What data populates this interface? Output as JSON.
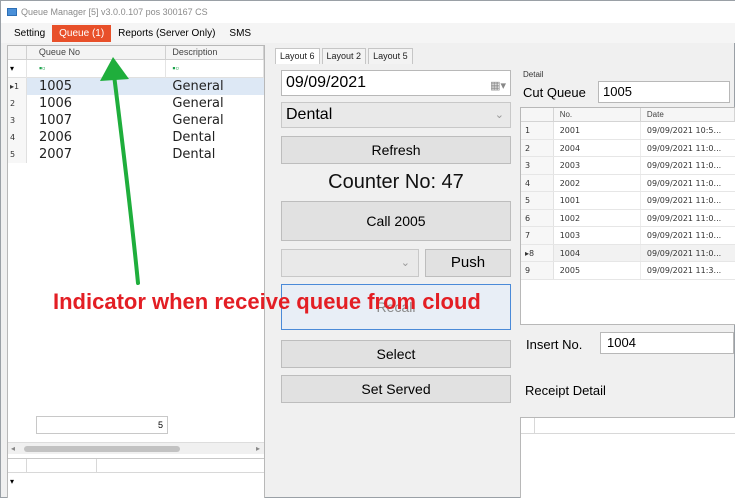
{
  "window": {
    "title": "Queue Manager [5] v3.0.0.107 pos 300167 CS"
  },
  "menu": {
    "items": [
      {
        "label": "Setting",
        "active": false
      },
      {
        "label": "Queue (1)",
        "active": true
      },
      {
        "label": "Reports (Server Only)",
        "active": false
      },
      {
        "label": "SMS",
        "active": false
      }
    ]
  },
  "queue_grid": {
    "columns": [
      "Queue No",
      "Description"
    ],
    "rows": [
      {
        "indicator": "▸1",
        "queue_no": "1005",
        "description": "General",
        "selected": true
      },
      {
        "indicator": "2",
        "queue_no": "1006",
        "description": "General",
        "selected": false
      },
      {
        "indicator": "3",
        "queue_no": "1007",
        "description": "General",
        "selected": false
      },
      {
        "indicator": "4",
        "queue_no": "2006",
        "description": "Dental",
        "selected": false
      },
      {
        "indicator": "5",
        "queue_no": "2007",
        "description": "Dental",
        "selected": false
      }
    ],
    "total_count": "5"
  },
  "tabs": [
    "Layout 6",
    "Layout 2",
    "Layout 5"
  ],
  "controls": {
    "date": "09/09/2021",
    "department": "Dental",
    "refresh_label": "Refresh",
    "counter_label": "Counter No: 47",
    "call_label": "Call 2005",
    "push_label": "Push",
    "recall_label": "Recall",
    "select_label": "Select",
    "set_served_label": "Set Served"
  },
  "detail": {
    "label": "Detail",
    "cut_queue_label": "Cut Queue",
    "cut_queue_value": "1005",
    "columns": [
      "No.",
      "Date"
    ],
    "rows": [
      {
        "idx": "1",
        "no": "2001",
        "date": "09/09/2021 10:5..."
      },
      {
        "idx": "2",
        "no": "2004",
        "date": "09/09/2021 11:0..."
      },
      {
        "idx": "3",
        "no": "2003",
        "date": "09/09/2021 11:0..."
      },
      {
        "idx": "4",
        "no": "2002",
        "date": "09/09/2021 11:0..."
      },
      {
        "idx": "5",
        "no": "1001",
        "date": "09/09/2021 11:0..."
      },
      {
        "idx": "6",
        "no": "1002",
        "date": "09/09/2021 11:0..."
      },
      {
        "idx": "7",
        "no": "1003",
        "date": "09/09/2021 11:0..."
      },
      {
        "idx": "▸8",
        "no": "1004",
        "date": "09/09/2021 11:0..."
      },
      {
        "idx": "9",
        "no": "2005",
        "date": "09/09/2021 11:3..."
      }
    ],
    "insert_label": "Insert No.",
    "insert_value": "1004",
    "receipt_label": "Receipt Detail"
  },
  "annotation": {
    "text": "Indicator when receive queue from cloud",
    "color": "#e31e24",
    "arrow_color": "#1fae3c"
  }
}
